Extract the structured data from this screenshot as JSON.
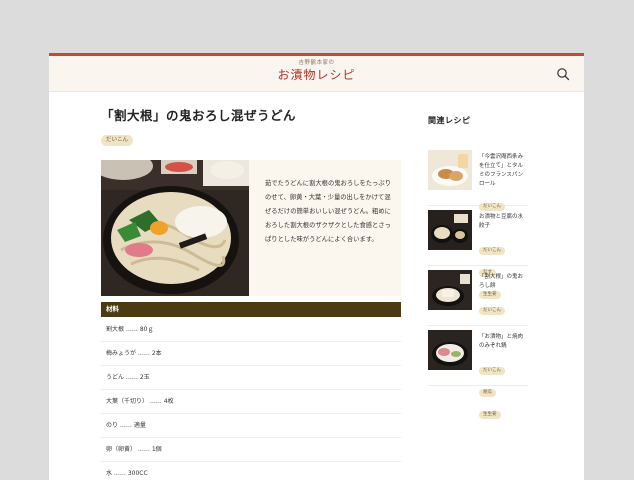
{
  "header": {
    "logo_sub": "吉野鶴本家の",
    "logo_main": "お漬物レシピ"
  },
  "recipe": {
    "title": "「割大根」の鬼おろし混ぜうどん",
    "tag": "だいこん",
    "description": "茹でたうどんに割大根の鬼おろしをたっぷりのせて、卵黄・大葉・少量の出しをかけて混ぜるだけの簡単おいしい混ぜうどん。粗めにおろした割大根のザクザクとした食感とさっぱりとした味がうどんによく合います。",
    "ingredients_heading": "材料",
    "ingredients": [
      "割大根 ……  80ｇ",
      "梅みょうが ……  2本",
      "うどん ……  2玉",
      "大葉（千切り） ……  4枚",
      "のり ……  適量",
      "卵（卵黄） ……  1個",
      "水 ……  300CC"
    ]
  },
  "sidebar": {
    "title": "関連レシピ",
    "items": [
      {
        "title": "「今雲沢庵西条みを仕立て」とタルミのフランスパンロール",
        "tags": [
          "だいこん"
        ]
      },
      {
        "title": "お漬物と豆腐の水餃子",
        "tags": [
          "だいこん",
          "なす",
          "生生姜"
        ]
      },
      {
        "title": "「割大根」の鬼おろし餅",
        "tags": [
          "だいこん"
        ]
      },
      {
        "title": "「お漬物」と焼肉のみぞれ鍋",
        "tags": [
          "だいこん",
          "胡瓜",
          "生生姜"
        ]
      }
    ]
  }
}
